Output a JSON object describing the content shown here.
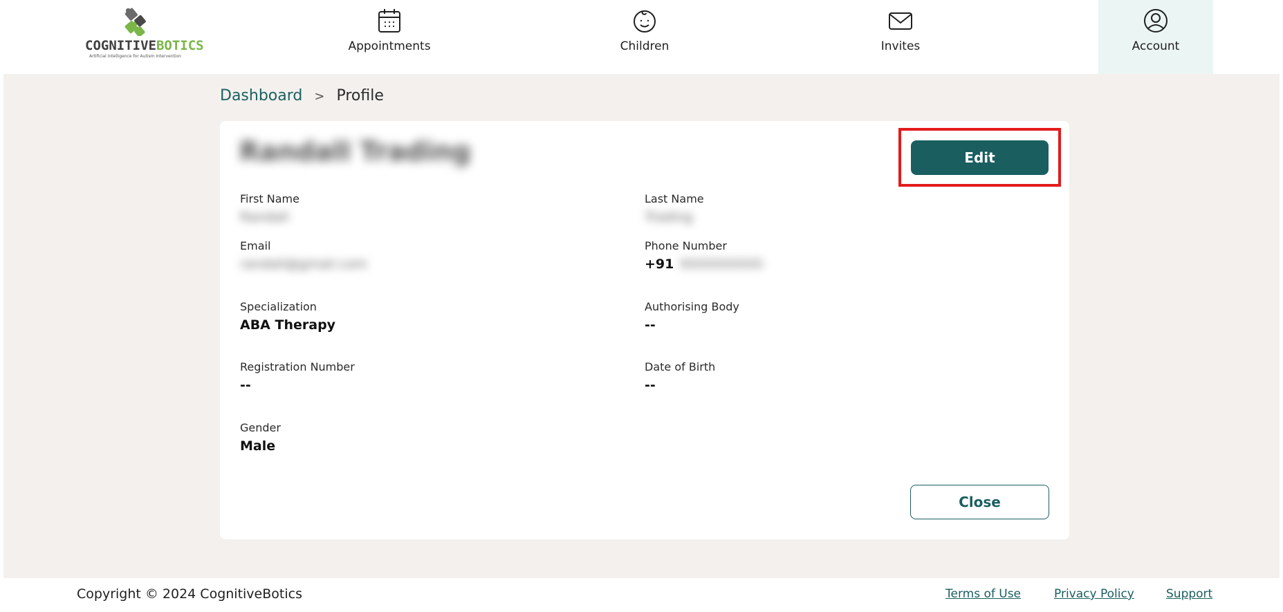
{
  "brand": {
    "name_part1": "COGNITIVE",
    "name_part2": "BOTICS",
    "tagline": "Artificial Intelligence for Autism Intervention",
    "colors": {
      "dark": "#3f3f3f",
      "green": "#7ab648"
    }
  },
  "nav": {
    "items": [
      {
        "label": "Appointments",
        "icon": "calendar-icon"
      },
      {
        "label": "Children",
        "icon": "baby-face-icon"
      },
      {
        "label": "Invites",
        "icon": "envelope-icon"
      },
      {
        "label": "Account",
        "icon": "user-circle-icon",
        "active": true
      }
    ]
  },
  "breadcrumb": {
    "link": "Dashboard",
    "separator": ">",
    "current": "Profile"
  },
  "profile": {
    "name": "Randall Trading",
    "fields": {
      "first_name": {
        "label": "First Name",
        "value": "Randall"
      },
      "last_name": {
        "label": "Last Name",
        "value": "Trading"
      },
      "email": {
        "label": "Email",
        "value": "randall@gmail.com"
      },
      "phone": {
        "label": "Phone Number",
        "prefix": "+91",
        "value": "9000000000"
      },
      "specialization": {
        "label": "Specialization",
        "value": "ABA Therapy"
      },
      "authorising_body": {
        "label": "Authorising Body",
        "value": "--"
      },
      "registration_number": {
        "label": "Registration Number",
        "value": "--"
      },
      "date_of_birth": {
        "label": "Date of Birth",
        "value": "--"
      },
      "gender": {
        "label": "Gender",
        "value": "Male"
      }
    },
    "edit_label": "Edit",
    "close_label": "Close"
  },
  "footer": {
    "copyright": "Copyright © 2024 CognitiveBotics",
    "links": {
      "terms": "Terms of Use",
      "privacy": "Privacy Policy",
      "support": "Support"
    }
  },
  "colors": {
    "primary": "#1a5e60",
    "background": "#f3f0ed",
    "highlight": "#e31b1b",
    "nav_active_bg": "#eaf5f4"
  }
}
